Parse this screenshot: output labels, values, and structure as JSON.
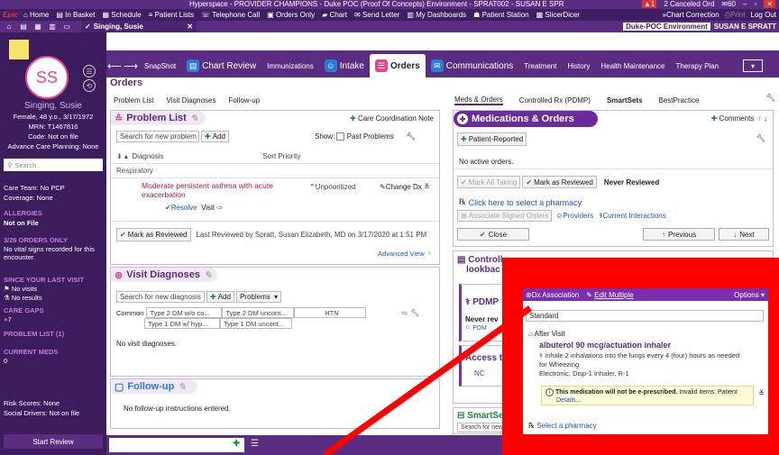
{
  "titlebar": {
    "title": "Hyperspace - PROVIDER CHAMPIONS - Duke POC (Proof Of Concepts) Environment - SPRAT002 - SUSAN E SPR",
    "alerts": "1",
    "canceled": "2 Canceled Ord",
    "messages": "60"
  },
  "toolbar1": {
    "logo": "Epic",
    "items": [
      "Home",
      "In Basket",
      "Schedule",
      "Patient Lists",
      "Telephone Call",
      "Orders Only",
      "Chart",
      "Send Letter",
      "My Dashboards",
      "Patient Station",
      "SlicerDicer"
    ],
    "right": [
      "Chart Correction",
      "Print",
      "Log Out"
    ]
  },
  "toolbar2": {
    "patient_tab": "Singing, Susie",
    "environment": "Duke-POC Environment",
    "user": "SUSAN E SPRATT"
  },
  "sidebar": {
    "initials": "SS",
    "name": "Singing, Susie",
    "demographics": "Female, 48 y.o., 3/17/1972",
    "mrn": "MRN: T1467816",
    "code": "Code: Not on file",
    "acp": "Advance Care Planning: None",
    "search_placeholder": "Search",
    "care_team": "Care Team: No PCP",
    "coverage": "Coverage: None",
    "allergies_header": "ALLERGIES",
    "allergies_value": "Not on File",
    "orders_header": "3/26 ORDERS ONLY",
    "orders_value": "No vital signs recorded for this encounter.",
    "since_header": "SINCE YOUR LAST VISIT",
    "no_visits": "No visits",
    "no_results": "No results",
    "care_gaps_header": "CARE GAPS",
    "care_gaps_count": "7",
    "problem_list_header": "PROBLEM LIST (1)",
    "current_meds_header": "CURRENT MEDS",
    "current_meds_count": "0",
    "risk_scores": "Risk Scores: None",
    "social_drivers": "Social Drivers: Not on file",
    "start_review": "Start Review"
  },
  "activity_tabs": [
    "SnapShot",
    "Chart Review",
    "Immunizations",
    "Intake",
    "Orders",
    "Communications",
    "Treatment",
    "History",
    "Health Maintenance",
    "Therapy Plan"
  ],
  "orders_title": "Orders",
  "left_tabs": [
    "Problem List",
    "Visit Diagnoses",
    "Follow-up"
  ],
  "problem_list": {
    "title": "Problem List",
    "care_coord": "Care Coordination Note",
    "search_placeholder": "Search for new problem",
    "add": "Add",
    "show": "Show:",
    "past_problems": "Past Problems",
    "col_diagnosis": "Diagnosis",
    "col_priority": "Sort Priority",
    "group": "Respiratory",
    "problem_line1": "Moderate persistent asthma with acute",
    "problem_line2": "exacerbation",
    "unprioritized": "Unprioritized",
    "change_dx": "Change Dx",
    "resolve": "Resolve",
    "visit": "Visit",
    "mark_reviewed": "Mark as Reviewed",
    "last_reviewed": "Last Reviewed by Spratt, Susan Elizabeth, MD on 3/17/2020 at 1:51 PM",
    "advanced_view": "Advanced View"
  },
  "visit_dx": {
    "title": "Visit Diagnoses",
    "search_placeholder": "Search for new diagnosis",
    "add": "Add",
    "problems": "Problems",
    "common": "Common",
    "c1": "Type 2 DM w/o co...",
    "c2": "Type 2 DM uncont...",
    "c3": "HTN",
    "c4": "Type 1 DM w/ hyp...",
    "c5": "Type 1 DM uncont...",
    "none": "No visit diagnoses."
  },
  "followup": {
    "title": "Follow-up",
    "none": "No follow-up instructions entered."
  },
  "right_tabs": [
    "Meds & Orders",
    "Controlled Rx (PDMP)",
    "SmartSets",
    "BestPractice"
  ],
  "meds_orders": {
    "title": "Medications & Orders",
    "comments": "Comments",
    "patient_reported": "Patient-Reported",
    "no_active": "No active orders.",
    "mark_all_taking": "Mark All Taking",
    "mark_reviewed": "Mark as Reviewed",
    "never_reviewed": "Never Reviewed",
    "select_pharmacy": "Click here to select a pharmacy",
    "associate": "Associate Signed Orders",
    "providers": "Providers",
    "interactions": "Current Interactions",
    "close": "Close",
    "previous": "Previous",
    "next": "Next"
  },
  "controlled": {
    "title_line1": "Controll",
    "title_line2": "lookbac",
    "pdmp": "PDMP",
    "never_rev": "Never rev",
    "pdm": "PDM",
    "access": "Access t",
    "nc": "NC"
  },
  "smartsets": {
    "title": "SmartSe",
    "search": "Search for new"
  },
  "popup": {
    "dx_association": "Dx Association",
    "edit_multiple": "Edit Multiple",
    "options": "Options",
    "standard": "Standard",
    "after_visit": "After Visit",
    "medication": "albuterol 90 mcg/actuation inhaler",
    "sig_line1": "Inhale 2 inhalations into the lungs every 4 (four) hours as needed",
    "sig_line2": "for Wheezing",
    "sig_line3": "Electronic, Disp-1 Inhaler, R-1",
    "warning_a": "This medication will not be e-prescribed.",
    "warning_b": "Invalid items: Patient",
    "warning_c": "Details...",
    "select_pharmacy": "Select a pharmacy"
  },
  "colors": {
    "brand": "#5a2d82",
    "sidebar": "#3b1c5c",
    "accent_red": "#ff0000",
    "pink": "#e24a8c"
  }
}
